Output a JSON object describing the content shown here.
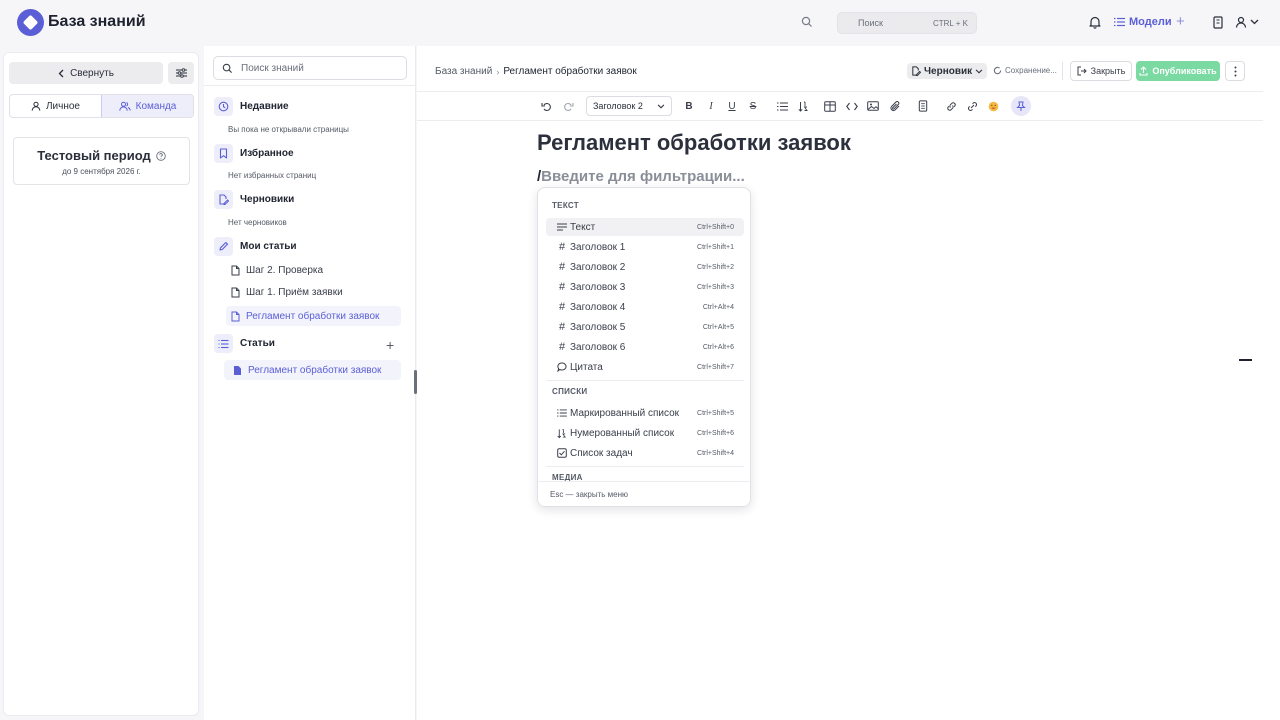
{
  "app": {
    "title": "База знаний"
  },
  "header": {
    "search_placeholder": "Поиск",
    "search_shortcut": "CTRL + K",
    "models_label": "Модели"
  },
  "sidebar_left": {
    "collapse_label": "Свернуть",
    "tabs": [
      {
        "label": "Личное",
        "active": false
      },
      {
        "label": "Команда",
        "active": true
      }
    ],
    "trial": {
      "title": "Тестовый период",
      "until": "до 9 сентября 2026 г."
    }
  },
  "sidebar_mid": {
    "search_placeholder": "Поиск знаний",
    "recent": {
      "title": "Недавние",
      "empty": "Вы пока не открывали страницы"
    },
    "favorites": {
      "title": "Избранное",
      "empty": "Нет избранных страниц"
    },
    "drafts": {
      "title": "Черновики",
      "empty": "Нет черновиков"
    },
    "my_articles": {
      "title": "Мои статьи",
      "items": [
        "Шаг 2. Проверка",
        "Шаг 1. Приём заявки",
        "Регламент обработки заявок"
      ]
    },
    "articles": {
      "title": "Статьи",
      "items": [
        "Регламент обработки заявок"
      ]
    }
  },
  "editor": {
    "breadcrumb_root": "База знаний",
    "breadcrumb_current": "Регламент обработки заявок",
    "status": "Черновик",
    "saving": "Сохранение...",
    "close_label": "Закрыть",
    "publish_label": "Опубликовать",
    "heading_select": "Заголовок 2",
    "doc_title": "Регламент обработки заявок",
    "slash_char": "/",
    "slash_placeholder": "Введите для фильтрации..."
  },
  "slash_menu": {
    "group_text": "ТЕКСТ",
    "group_lists": "СПИСКИ",
    "group_media": "МЕДИА",
    "items": [
      {
        "label": "Текст",
        "shortcut": "Ctrl+Shift+0",
        "icon": "text-lines-icon"
      },
      {
        "label": "Заголовок 1",
        "shortcut": "Ctrl+Shift+1",
        "icon": "hash-icon"
      },
      {
        "label": "Заголовок 2",
        "shortcut": "Ctrl+Shift+2",
        "icon": "hash-icon"
      },
      {
        "label": "Заголовок 3",
        "shortcut": "Ctrl+Shift+3",
        "icon": "hash-icon"
      },
      {
        "label": "Заголовок 4",
        "shortcut": "Ctrl+Alt+4",
        "icon": "hash-icon"
      },
      {
        "label": "Заголовок 5",
        "shortcut": "Ctrl+Alt+5",
        "icon": "hash-icon"
      },
      {
        "label": "Заголовок 6",
        "shortcut": "Ctrl+Alt+6",
        "icon": "hash-icon"
      },
      {
        "label": "Цитата",
        "shortcut": "Ctrl+Shift+7",
        "icon": "quote-icon"
      },
      {
        "label": "Маркированный список",
        "shortcut": "Ctrl+Shift+5",
        "icon": "bullet-list-icon"
      },
      {
        "label": "Нумерованный список",
        "shortcut": "Ctrl+Shift+6",
        "icon": "numbered-list-icon"
      },
      {
        "label": "Список задач",
        "shortcut": "Ctrl+Shift+4",
        "icon": "checkbox-icon"
      }
    ],
    "footer": "Esc — закрыть меню"
  },
  "colors": {
    "accent": "#5a5fd6",
    "publish": "#7bd9a2",
    "background": "#f6f6f8"
  }
}
